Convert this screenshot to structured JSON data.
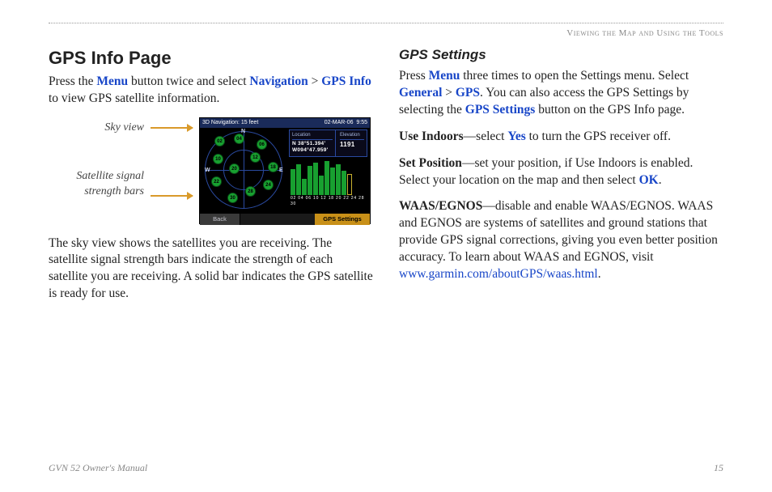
{
  "breadcrumb": "Viewing the Map and Using the Tools",
  "left": {
    "h2": "GPS Info Page",
    "p1": {
      "t1": "Press the ",
      "menu": "Menu",
      "t2": " button twice and select ",
      "nav": "Navigation",
      "t3": " > ",
      "gpsinfo": "GPS Info",
      "t4": " to view GPS satellite information."
    },
    "cap1": "Sky view",
    "cap2": "Satellite signal strength bars",
    "p2": "The sky view shows the satellites you are receiving. The satellite signal strength bars indicate the strength of each satellite you are receiving. A solid bar indicates the GPS satellite is ready for use."
  },
  "right": {
    "h3": "GPS Settings",
    "p1": {
      "t1": "Press ",
      "menu": "Menu",
      "t2": " three times to open the Settings menu. Select ",
      "general": "General",
      "t3": " > ",
      "gps": "GPS",
      "t4": ". You can also access the GPS Settings by selecting the ",
      "gpsset": "GPS Settings",
      "t5": " button on the GPS Info page."
    },
    "p2": {
      "b": "Use Indoors",
      "t1": "—select ",
      "yes": "Yes",
      "t2": " to turn the GPS receiver off."
    },
    "p3": {
      "b": "Set Position",
      "t1": "—set your position, if Use Indoors is enabled. Select your location on the map and then select ",
      "ok": "OK",
      "t2": "."
    },
    "p4": {
      "b": "WAAS/EGNOS",
      "t1": "—disable and enable WAAS/EGNOS. WAAS and EGNOS are systems of satellites and ground stations that provide GPS signal corrections, giving you even better position accuracy. To learn about WAAS and EGNOS, visit ",
      "url": "www.garmin.com/aboutGPS/waas.html",
      "t2": "."
    }
  },
  "ss": {
    "title": "3D Navigation: 15 feet",
    "date": "02-MAR-06",
    "time": "9:55",
    "n": "N",
    "e": "E",
    "w": "W",
    "loc_label": "Location",
    "loc_val1": "N 38°51.394'",
    "loc_val2": "W094°47.959'",
    "elev_label": "Elevation",
    "elev_val": "1191",
    "barnums": "02 04 06 10 12 18 20 22 24 28 30",
    "back": "Back",
    "settings": "GPS Settings"
  },
  "footer": {
    "left": "GVN 52 Owner's Manual",
    "right": "15"
  }
}
